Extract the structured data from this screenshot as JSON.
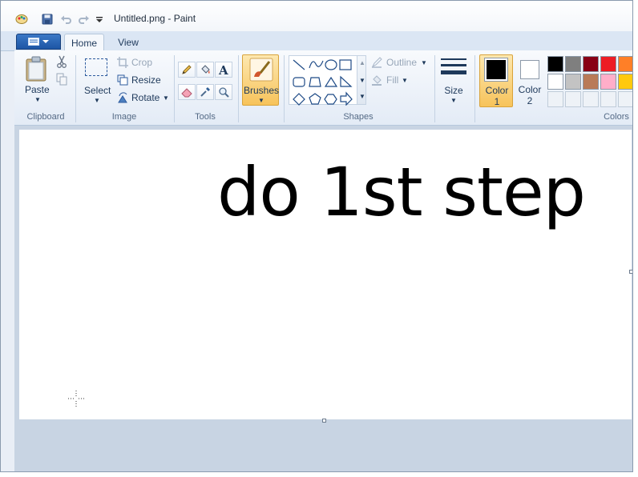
{
  "window": {
    "title": "Untitled.png - Paint"
  },
  "quick_access": {
    "icons": [
      "paint-app-icon",
      "save-icon",
      "undo-icon",
      "redo-icon",
      "customize-qat-icon"
    ]
  },
  "tabs": [
    {
      "label": "Home",
      "active": true
    },
    {
      "label": "View",
      "active": false
    }
  ],
  "ribbon": {
    "clipboard": {
      "group_label": "Clipboard",
      "paste_label": "Paste"
    },
    "image": {
      "group_label": "Image",
      "select_label": "Select",
      "crop_label": "Crop",
      "resize_label": "Resize",
      "rotate_label": "Rotate"
    },
    "tools": {
      "group_label": "Tools",
      "items": [
        "pencil-icon",
        "fill-bucket-icon",
        "text-icon",
        "eraser-icon",
        "color-picker-icon",
        "magnifier-icon"
      ]
    },
    "brushes": {
      "label": "Brushes"
    },
    "shapes": {
      "group_label": "Shapes",
      "outline_label": "Outline",
      "fill_label": "Fill"
    },
    "size": {
      "label": "Size"
    },
    "colors": {
      "group_label": "Colors",
      "color1_label": "Color",
      "color1_num": "1",
      "color2_label": "Color",
      "color2_num": "2",
      "color1_value": "#000000",
      "color2_value": "#ffffff",
      "palette_row1": [
        "#000000",
        "#7f7f7f",
        "#880015",
        "#ed1c24",
        "#ff7f27"
      ],
      "palette_row2": [
        "#ffffff",
        "#c3c3c3",
        "#b97a57",
        "#ffaec9",
        "#ffc90e"
      ],
      "palette_row3": [
        "",
        "",
        "",
        "",
        ""
      ]
    }
  },
  "canvas": {
    "text": "do 1st step",
    "background": "#ffffff"
  }
}
